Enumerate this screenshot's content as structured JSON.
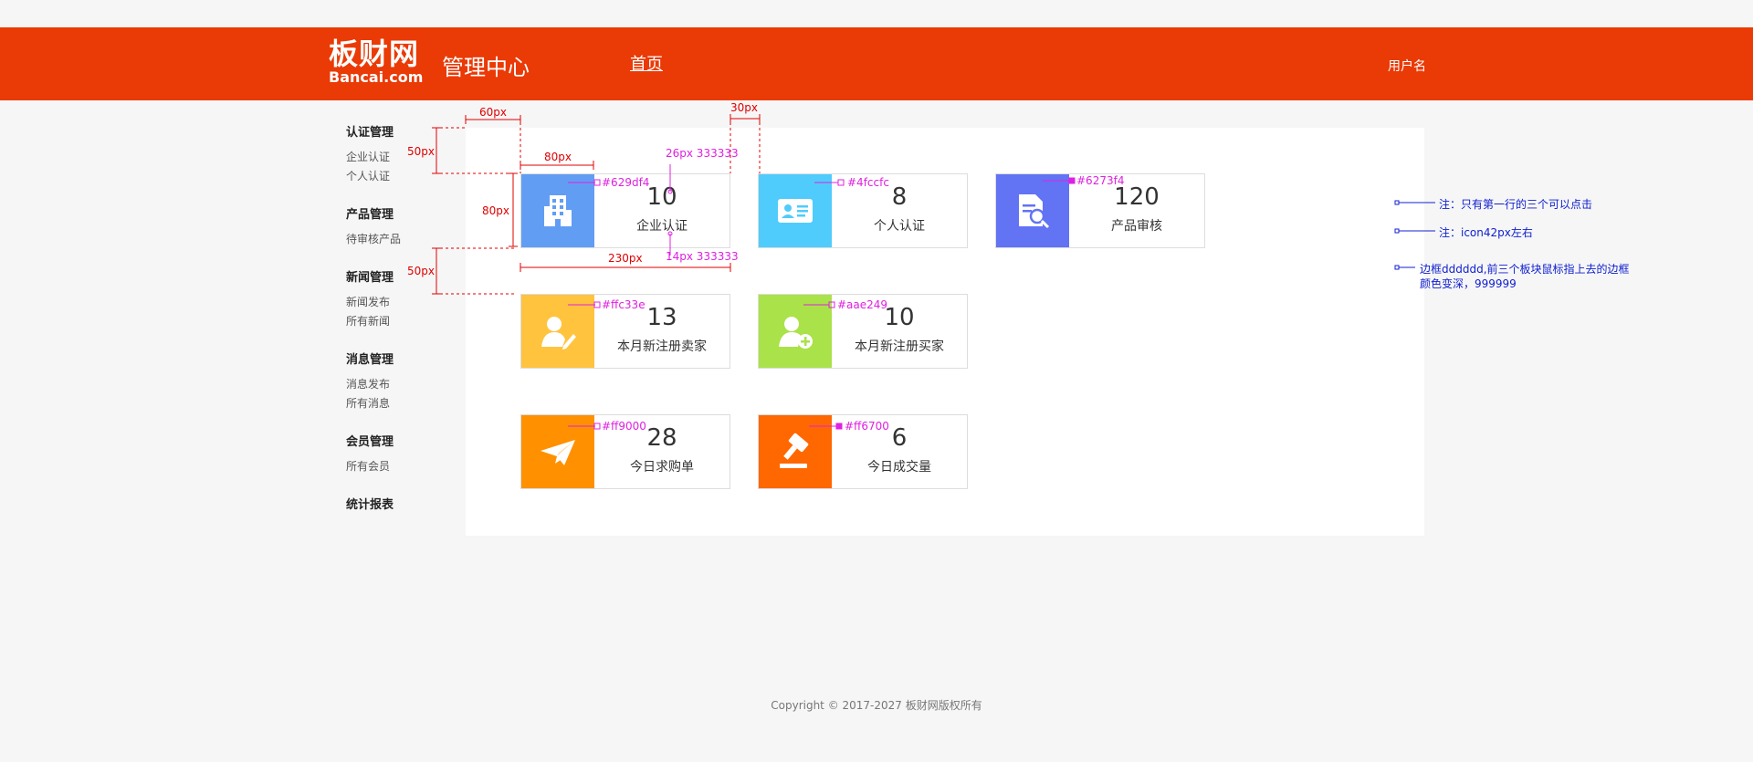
{
  "header": {
    "logo_cn": "板财网",
    "logo_en": "Bancai.com",
    "title": "管理中心",
    "nav_home": "首页",
    "username": "用户名"
  },
  "sidebar": [
    {
      "title": "认证管理",
      "items": [
        "企业认证",
        "个人认证"
      ]
    },
    {
      "title": "产品管理",
      "items": [
        "待审核产品"
      ]
    },
    {
      "title": "新闻管理",
      "items": [
        "新闻发布",
        "所有新闻"
      ]
    },
    {
      "title": "消息管理",
      "items": [
        "消息发布",
        "所有消息"
      ]
    },
    {
      "title": "会员管理",
      "items": [
        "所有会员"
      ]
    },
    {
      "title": "统计报表",
      "items": []
    }
  ],
  "cards": [
    {
      "value": "10",
      "label": "企业认证",
      "color": "#629df4",
      "icon": "building-icon",
      "annotation": "#629df4"
    },
    {
      "value": "8",
      "label": "个人认证",
      "color": "#4fccfc",
      "icon": "id-card-icon",
      "annotation": "#4fccfc"
    },
    {
      "value": "120",
      "label": "产品审核",
      "color": "#6273f4",
      "icon": "document-search-icon",
      "annotation": "#6273f4"
    },
    {
      "value": "13",
      "label": "本月新注册卖家",
      "color": "#ffc33e",
      "icon": "user-edit-icon",
      "annotation": "#ffc33e"
    },
    {
      "value": "10",
      "label": "本月新注册买家",
      "color": "#aae249",
      "icon": "user-add-icon",
      "annotation": "#aae249"
    },
    {
      "value": "28",
      "label": "今日求购单",
      "color": "#ff9000",
      "icon": "paper-plane-icon",
      "annotation": "#ff9000"
    },
    {
      "value": "6",
      "label": "今日成交量",
      "color": "#ff6700",
      "icon": "gavel-icon",
      "annotation": "#ff6700"
    }
  ],
  "annotations": {
    "dim_60": "60px",
    "dim_30": "30px",
    "dim_80w": "80px",
    "dim_80h": "80px",
    "dim_50a": "50px",
    "dim_50b": "50px",
    "dim_230": "230px",
    "font_num": "26px 333333",
    "font_label": "14px 333333",
    "note_click": "注：只有第一行的三个可以点击",
    "note_icon": "注：icon42px左右",
    "note_border_1": "边框dddddd,前三个板块鼠标指上去的边框",
    "note_border_2": "颜色变深，999999"
  },
  "footer": "Copyright © 2017-2027  板财网版权所有"
}
